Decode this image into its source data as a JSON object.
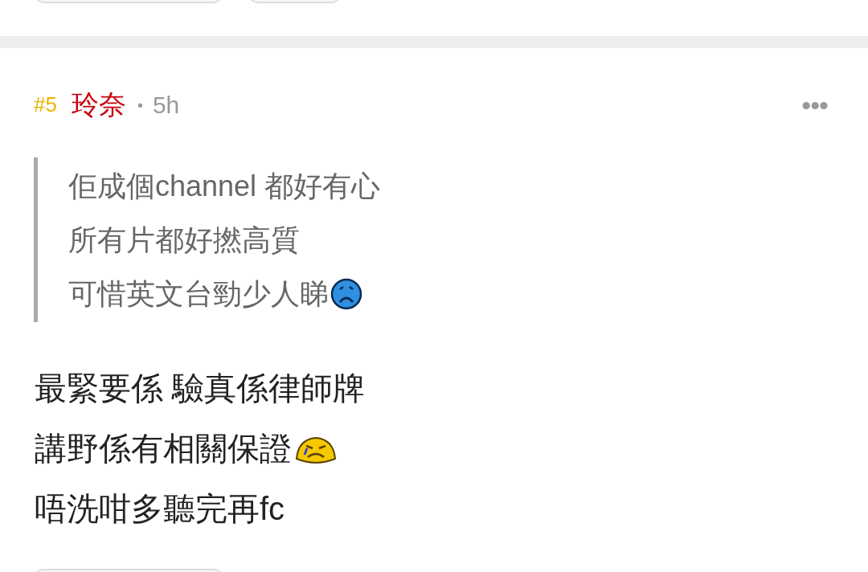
{
  "post": {
    "number": "#5",
    "author": "玲奈",
    "separator": "•",
    "time": "5h",
    "more": "•••",
    "quote": [
      {
        "text": "佢成個channel 都好有心",
        "kind": "plain"
      },
      {
        "text": "所有片都好撚高質",
        "kind": "plain"
      },
      {
        "text": "可惜英文台勁少人睇",
        "kind": "sad"
      }
    ],
    "body": [
      {
        "text": "最緊要係 驗真係律師牌",
        "kind": "plain"
      },
      {
        "text": "講野係有相關保證",
        "kind": "crying"
      },
      {
        "text": "唔洗咁多聽完再fc",
        "kind": "plain"
      }
    ]
  }
}
